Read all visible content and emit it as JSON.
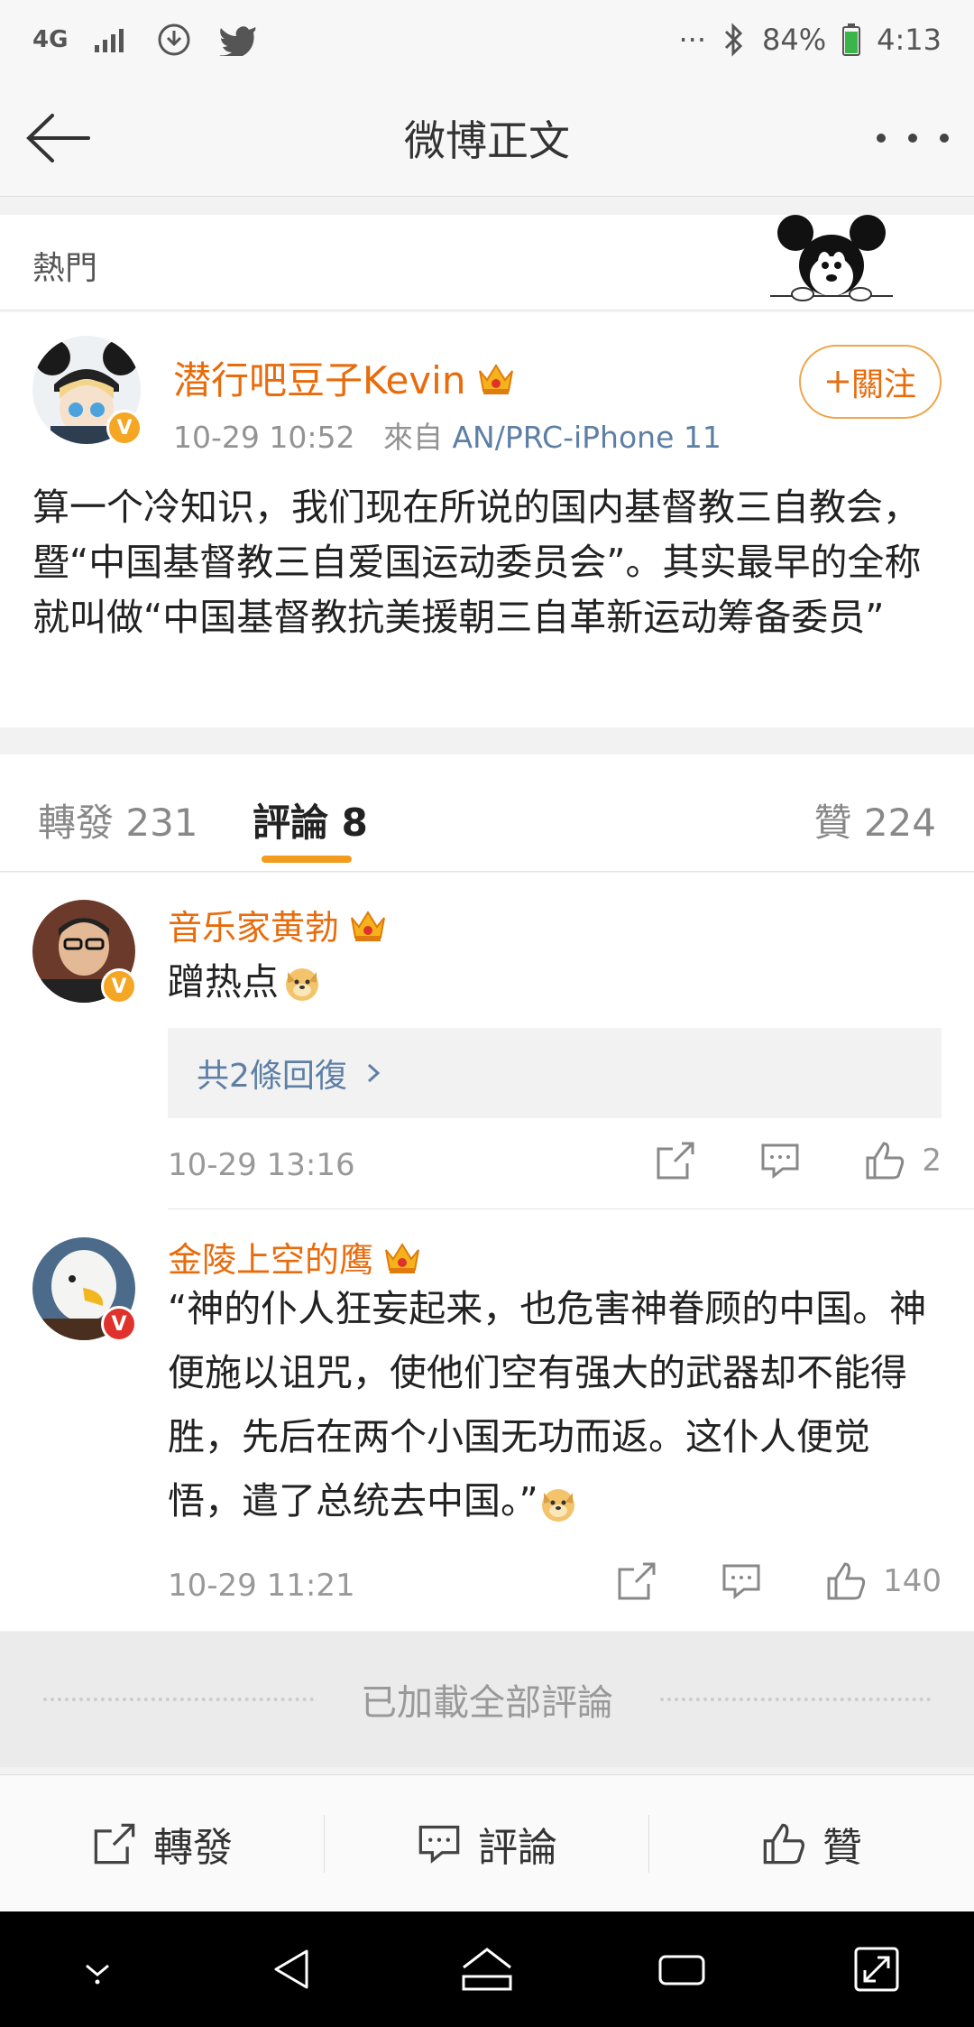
{
  "status_bar": {
    "network": "4G",
    "battery": "84%",
    "time": "4:13",
    "more": "···"
  },
  "nav": {
    "title": "微博正文"
  },
  "hot": {
    "label": "熱門"
  },
  "post": {
    "author": "潜行吧豆子Kevin",
    "verified": "V",
    "time": "10-29 10:52",
    "from_label": "來自",
    "source": "AN/PRC-iPhone 11",
    "follow_label": "關注",
    "text": "算一个冷知识，我们现在所说的国内基督教三自教会，暨“中国基督教三自爱国运动委员会”。其实最早的全称就叫做“中国基督教抗美援朝三自革新运动筹备委员”"
  },
  "tabs": {
    "repost": "轉發 231",
    "comment": "評論 8",
    "like": "贊 224"
  },
  "comments": [
    {
      "author": "音乐家黄勃",
      "verified": "V",
      "text": "蹭热点",
      "reply_summary": "共2條回復",
      "time": "10-29 13:16",
      "likes": "2"
    },
    {
      "author": "金陵上空的鹰",
      "verified": "V",
      "text": "“神的仆人狂妄起来，也危害神眷顾的中国。神便施以诅咒，使他们空有强大的武器却不能得胜，先后在两个小国无功而返。这仆人便觉悟，遣了总统去中国。”",
      "time": "10-29 11:21",
      "likes": "140"
    }
  ],
  "footer_note": "已加載全部評論",
  "bottom_bar": {
    "repost": "轉發",
    "comment": "評論",
    "like": "贊"
  },
  "colors": {
    "accent_orange": "#e86b0c",
    "link_blue": "#5d7fa6",
    "tab_underline": "#f29b1d"
  }
}
